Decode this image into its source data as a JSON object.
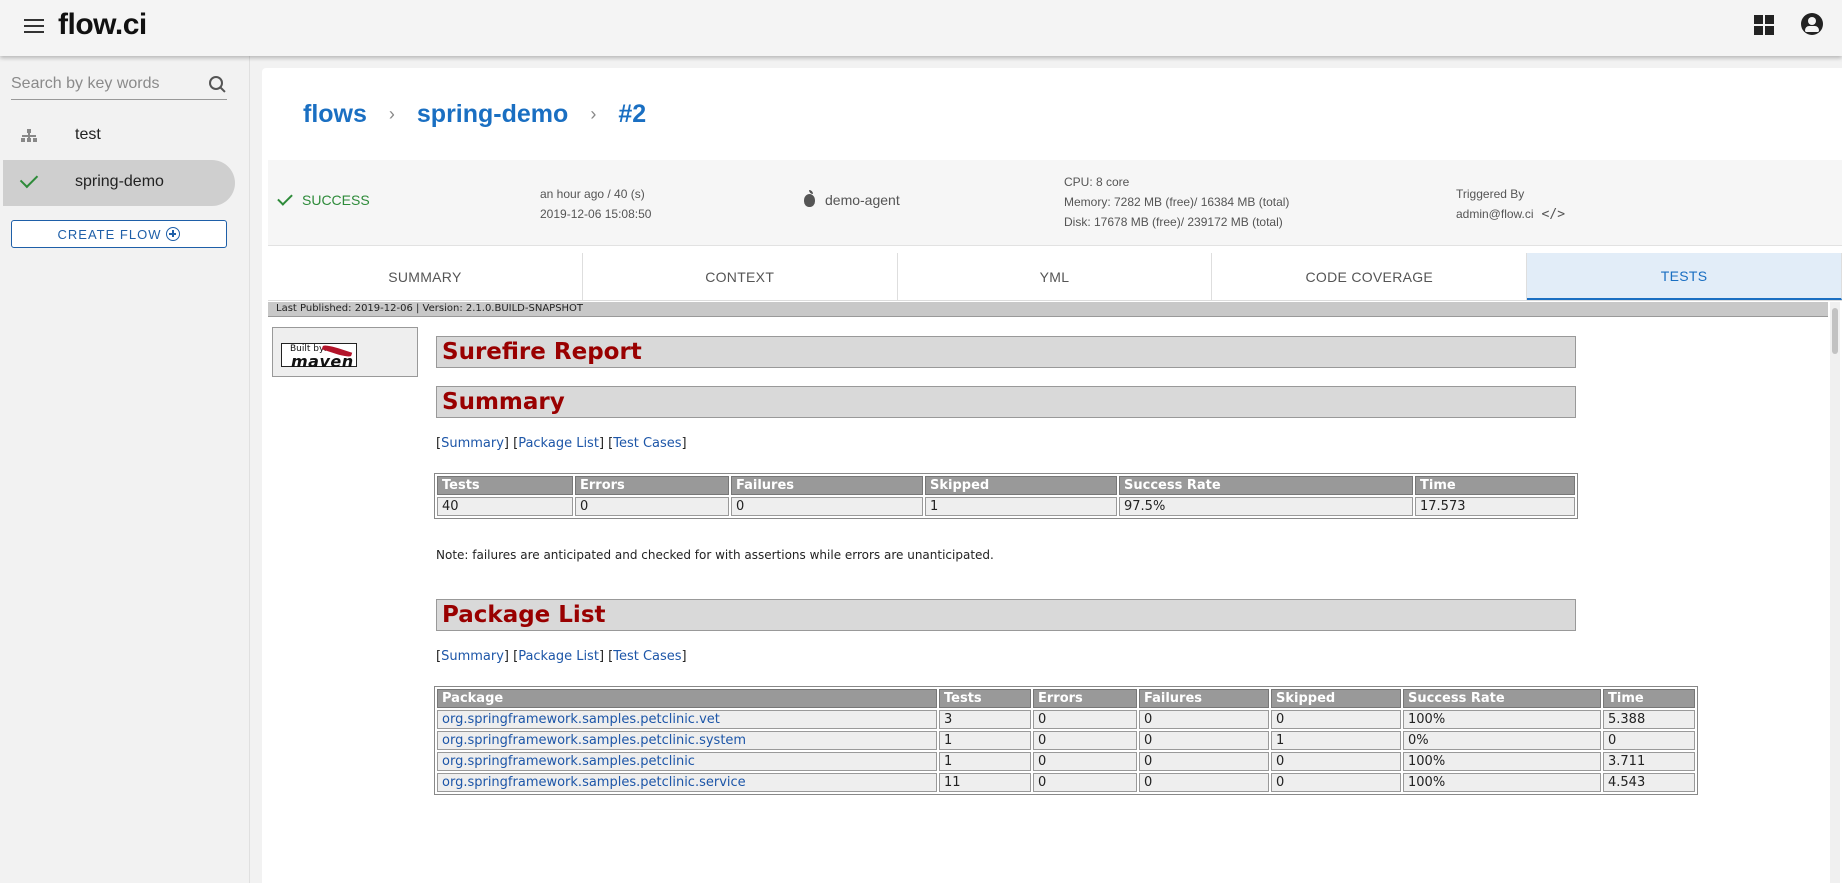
{
  "app": {
    "title": "flow.ci"
  },
  "sidebar": {
    "search_placeholder": "Search by key words",
    "items": [
      {
        "label": "test",
        "icon": "tree-icon",
        "active": false
      },
      {
        "label": "spring-demo",
        "icon": "check-icon",
        "active": true
      }
    ],
    "create_label": "CREATE FLOW"
  },
  "breadcrumb": {
    "flows": "flows",
    "flow": "spring-demo",
    "job": "#2"
  },
  "job": {
    "status": "SUCCESS",
    "duration": "an hour ago / 40 (s)",
    "started": "2019-12-06 15:08:50",
    "agent": "demo-agent",
    "cpu": "CPU: 8 core",
    "memory": "Memory: 7282 MB (free)/ 16384 MB (total)",
    "disk": "Disk: 17678 MB (free)/ 239172 MB (total)",
    "triggered_label": "Triggered By",
    "triggered_by": "admin@flow.ci"
  },
  "tabs": [
    "SUMMARY",
    "CONTEXT",
    "YML",
    "CODE COVERAGE",
    "TESTS"
  ],
  "report": {
    "banner": "Last Published: 2019-12-06  | Version: 2.1.0.BUILD-SNAPSHOT",
    "maven": {
      "built_by": "Built by:",
      "name": "maven"
    },
    "title": "Surefire Report",
    "summary_heading": "Summary",
    "nav": {
      "summary": "Summary",
      "package_list": "Package List",
      "test_cases": "Test Cases"
    },
    "summary_headers": [
      "Tests",
      "Errors",
      "Failures",
      "Skipped",
      "Success Rate",
      "Time"
    ],
    "summary_values": [
      "40",
      "0",
      "0",
      "1",
      "97.5%",
      "17.573"
    ],
    "note": "Note: failures are anticipated and checked for with assertions while errors are unanticipated.",
    "package_heading": "Package List",
    "package_headers": [
      "Package",
      "Tests",
      "Errors",
      "Failures",
      "Skipped",
      "Success Rate",
      "Time"
    ],
    "packages": [
      [
        "org.springframework.samples.petclinic.vet",
        "3",
        "0",
        "0",
        "0",
        "100%",
        "5.388"
      ],
      [
        "org.springframework.samples.petclinic.system",
        "1",
        "0",
        "0",
        "1",
        "0%",
        "0"
      ],
      [
        "org.springframework.samples.petclinic",
        "1",
        "0",
        "0",
        "0",
        "100%",
        "3.711"
      ],
      [
        "org.springframework.samples.petclinic.service",
        "11",
        "0",
        "0",
        "0",
        "100%",
        "4.543"
      ]
    ]
  }
}
